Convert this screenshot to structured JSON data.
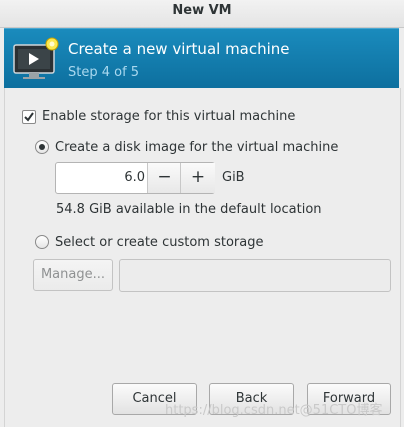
{
  "window": {
    "title": "New VM"
  },
  "banner": {
    "title": "Create a new virtual machine",
    "step": "Step 4 of 5",
    "icon": "monitor-with-new-star-icon"
  },
  "storage": {
    "enable_label": "Enable storage for this virtual machine",
    "enable_checked": true,
    "disk_image_label": "Create a disk image for the virtual machine",
    "disk_image_selected": true,
    "size_value": "6.0",
    "size_unit": "GiB",
    "decrement": "−",
    "increment": "+",
    "available_text": "54.8 GiB available in the default location",
    "custom_label": "Select or create custom storage",
    "custom_selected": false,
    "manage_label": "Manage...",
    "custom_path": ""
  },
  "buttons": {
    "cancel": "Cancel",
    "back": "Back",
    "forward": "Forward"
  },
  "watermark": "https://blog.csdn.net@51CTO博客"
}
